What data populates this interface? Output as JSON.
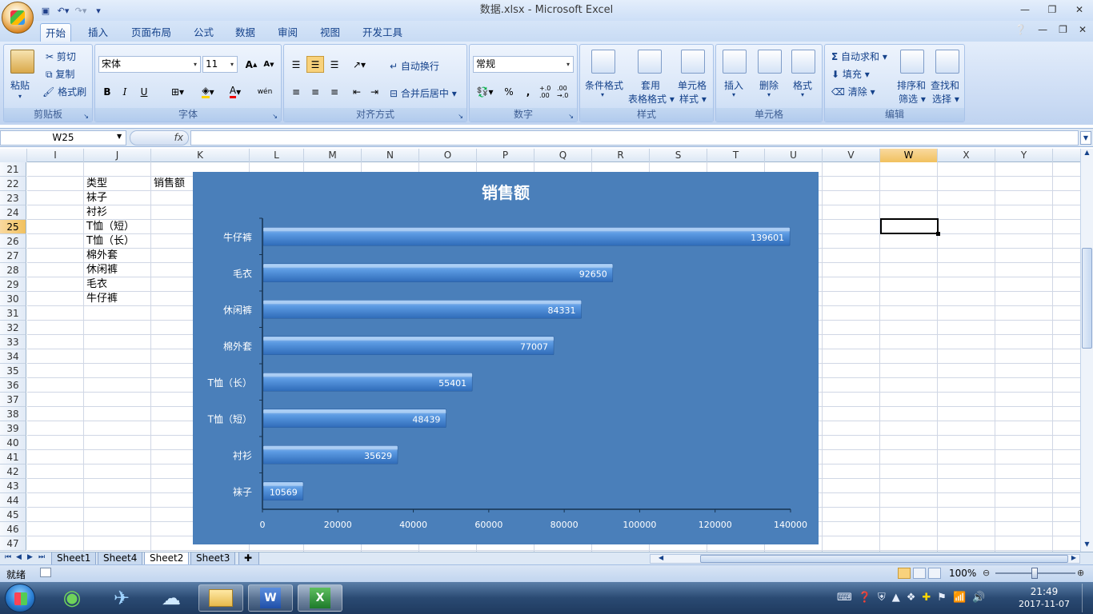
{
  "window": {
    "title": "数据.xlsx - Microsoft Excel"
  },
  "ribbon_tabs": [
    "开始",
    "插入",
    "页面布局",
    "公式",
    "数据",
    "审阅",
    "视图",
    "开发工具"
  ],
  "clipboard": {
    "paste": "粘贴",
    "cut": "剪切",
    "copy": "复制",
    "format_painter": "格式刷",
    "label": "剪贴板"
  },
  "font": {
    "name": "宋体",
    "size": "11",
    "label": "字体",
    "bold": "B",
    "italic": "I",
    "underline": "U",
    "color_glyph": "A",
    "phonetic": "wén"
  },
  "alignment": {
    "wrap": "自动换行",
    "merge": "合并后居中",
    "label": "对齐方式"
  },
  "number": {
    "format": "常规",
    "percent": "%",
    "comma": ",",
    "inc_decimal": "+.0 .00",
    "dec_decimal": ".00 →.0",
    "label": "数字"
  },
  "styles": {
    "conditional": "条件格式",
    "table_line1": "套用",
    "table_line2": "表格格式",
    "cell_line1": "单元格",
    "cell_line2": "样式",
    "label": "样式"
  },
  "cells": {
    "insert": "插入",
    "delete": "删除",
    "format": "格式",
    "label": "单元格"
  },
  "editing": {
    "autosum": "自动求和",
    "fill": "填充",
    "clear": "清除",
    "sort_line1": "排序和",
    "sort_line2": "筛选",
    "find_line1": "查找和",
    "find_line2": "选择",
    "label": "编辑"
  },
  "formula_bar": {
    "name_box": "W25",
    "fx": "fx"
  },
  "columns": [
    "I",
    "J",
    "K",
    "L",
    "M",
    "N",
    "O",
    "P",
    "Q",
    "R",
    "S",
    "T",
    "U",
    "V",
    "W",
    "X",
    "Y"
  ],
  "selected_column": "W",
  "rows": [
    "21",
    "22",
    "23",
    "24",
    "25",
    "26",
    "27",
    "28",
    "29",
    "30",
    "31",
    "32",
    "33",
    "34",
    "35",
    "36",
    "37",
    "38",
    "39",
    "40",
    "41",
    "42",
    "43",
    "44",
    "45",
    "46",
    "47"
  ],
  "selected_row": "25",
  "cell_text": {
    "j22": "类型",
    "k22": "销售额",
    "j23": "袜子",
    "j24": "衬衫",
    "j25": "T恤（短）",
    "j26": "T恤（长）",
    "j27": "棉外套",
    "j28": "休闲裤",
    "j29": "毛衣",
    "j30": "牛仔裤"
  },
  "chart_data": {
    "type": "bar",
    "title": "销售额",
    "categories": [
      "牛仔裤",
      "毛衣",
      "休闲裤",
      "棉外套",
      "T恤（长）",
      "T恤（短）",
      "衬衫",
      "袜子"
    ],
    "values": [
      139601,
      92650,
      84331,
      77007,
      55401,
      48439,
      35629,
      10569
    ],
    "xlim": [
      0,
      140000
    ],
    "ticks": [
      "0",
      "20000",
      "40000",
      "60000",
      "80000",
      "100000",
      "120000",
      "140000"
    ],
    "grid": false,
    "legend": "none",
    "bg_color": "#4a7fba",
    "bar_color": "#4f8fd6"
  },
  "sheets": [
    "Sheet1",
    "Sheet4",
    "Sheet2",
    "Sheet3"
  ],
  "active_sheet": "Sheet2",
  "status": {
    "ready": "就绪",
    "zoom": "100%"
  },
  "clock": {
    "time": "21:49",
    "date": "2017-11-07"
  }
}
